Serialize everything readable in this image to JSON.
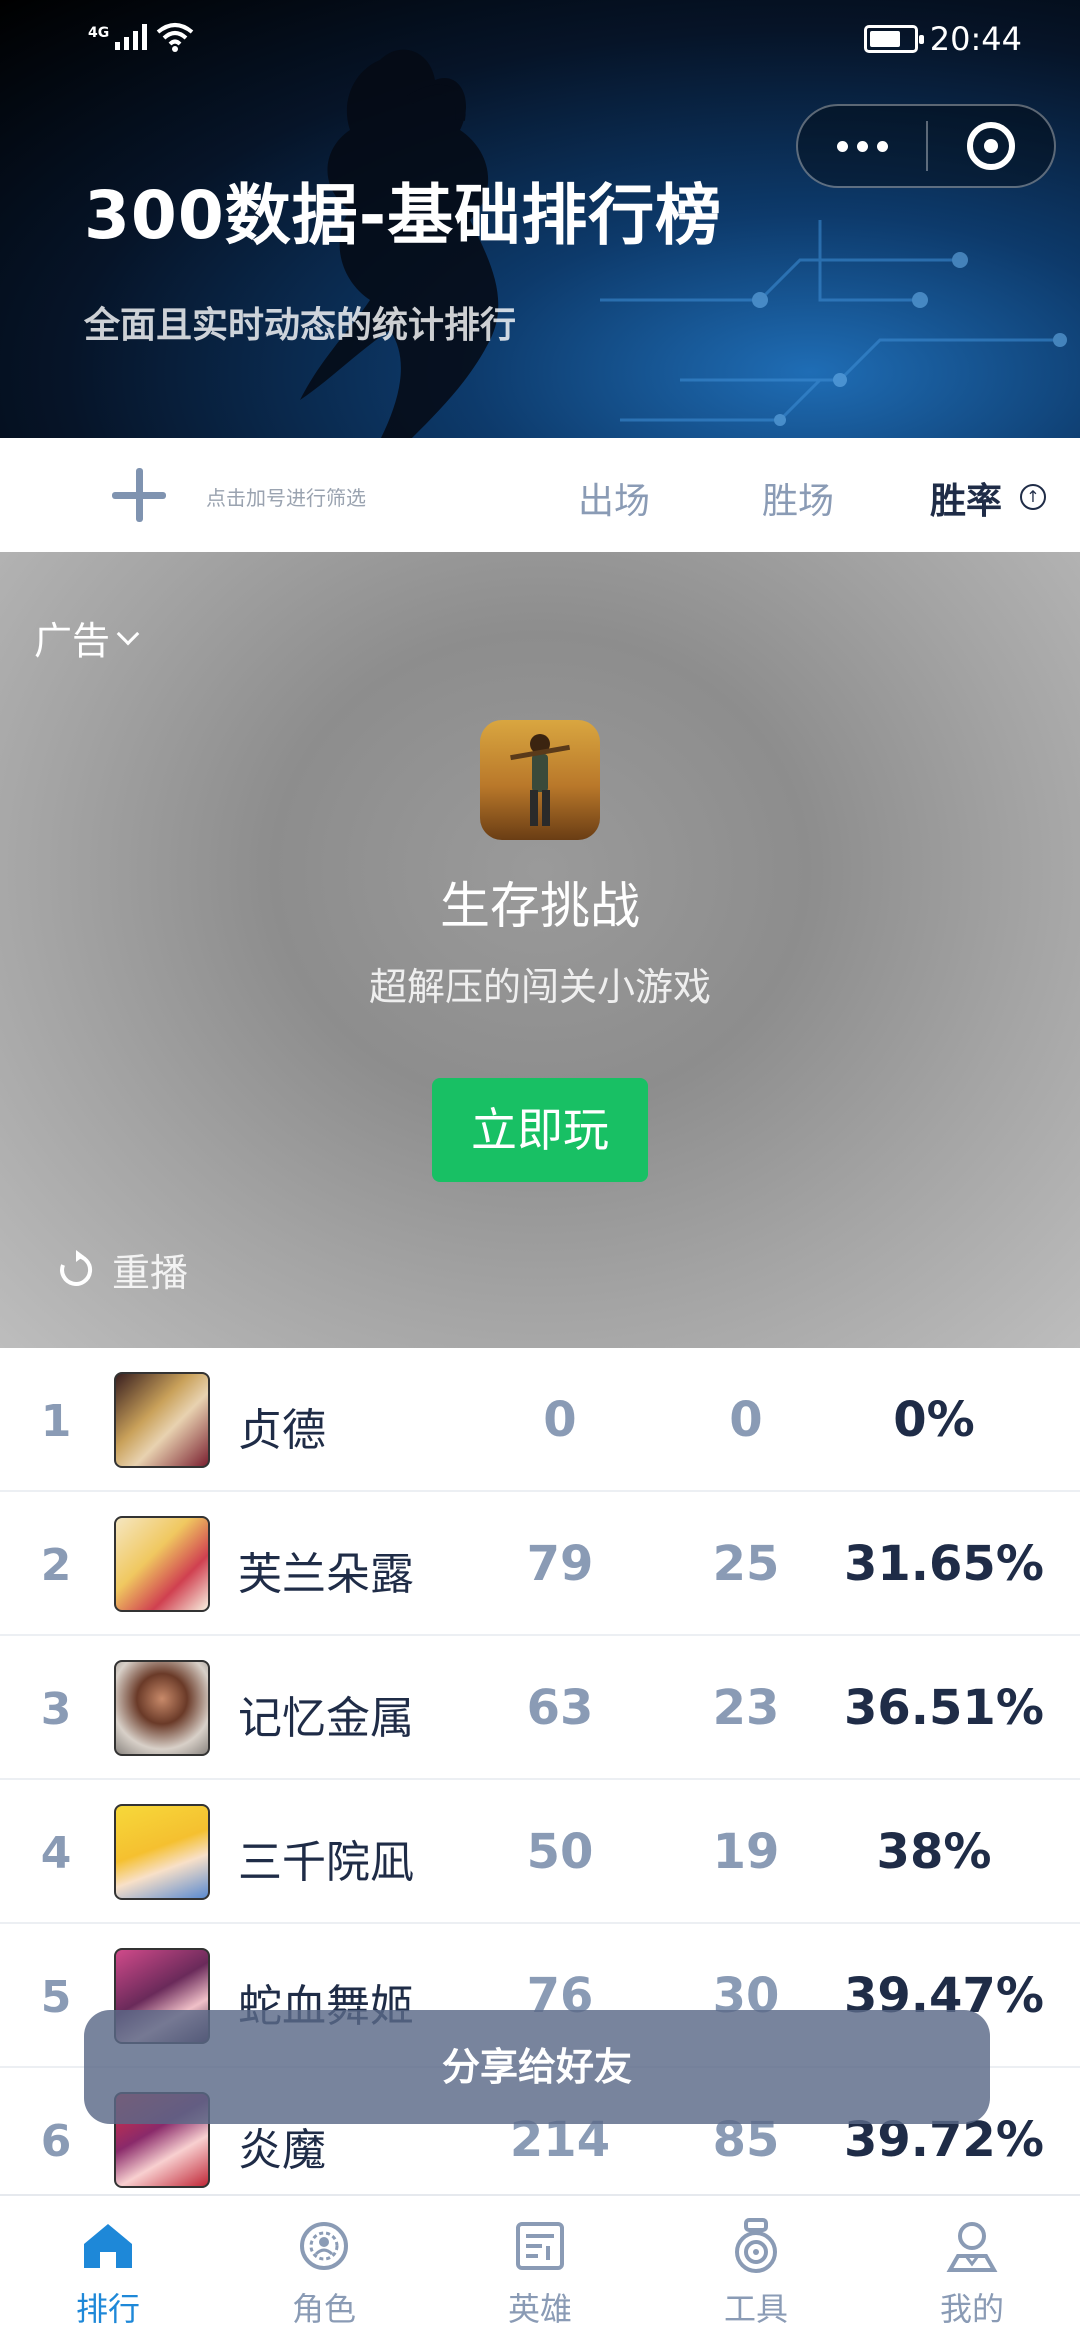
{
  "status_bar": {
    "network": "4G",
    "time": "20:44"
  },
  "header": {
    "title": "300数据-基础排行榜",
    "subtitle": "全面且实时动态的统计排行"
  },
  "filter_bar": {
    "hint": "点击加号进行筛选",
    "columns": [
      "出场",
      "胜场",
      "胜率"
    ],
    "active_column": "胜率",
    "sort_icon": "arrow-up-circle-icon"
  },
  "ad": {
    "label": "广告",
    "game_name": "生存挑战",
    "game_desc": "超解压的闯关小游戏",
    "play_label": "立即玩",
    "replay_label": "重播"
  },
  "rankings": [
    {
      "rank": "1",
      "name": "贞德",
      "appearances": "0",
      "wins": "0",
      "win_rate": "0%"
    },
    {
      "rank": "2",
      "name": "芙兰朵露",
      "appearances": "79",
      "wins": "25",
      "win_rate": "31.65%"
    },
    {
      "rank": "3",
      "name": "记忆金属",
      "appearances": "63",
      "wins": "23",
      "win_rate": "36.51%"
    },
    {
      "rank": "4",
      "name": "三千院凪",
      "appearances": "50",
      "wins": "19",
      "win_rate": "38%"
    },
    {
      "rank": "5",
      "name": "蛇血舞姬",
      "appearances": "76",
      "wins": "30",
      "win_rate": "39.47%"
    },
    {
      "rank": "6",
      "name": "炎魔",
      "appearances": "214",
      "wins": "85",
      "win_rate": "39.72%"
    }
  ],
  "share_label": "分享给好友",
  "tabs": [
    {
      "label": "排行",
      "icon": "home-icon",
      "active": true
    },
    {
      "label": "角色",
      "icon": "role-icon",
      "active": false
    },
    {
      "label": "英雄",
      "icon": "hero-icon",
      "active": false
    },
    {
      "label": "工具",
      "icon": "tools-icon",
      "active": false
    },
    {
      "label": "我的",
      "icon": "profile-icon",
      "active": false
    }
  ],
  "colors": {
    "accent": "#1e88d8",
    "rate_text": "#1f2c47",
    "muted_text": "#8a9bb5",
    "play_button": "#18c064"
  }
}
